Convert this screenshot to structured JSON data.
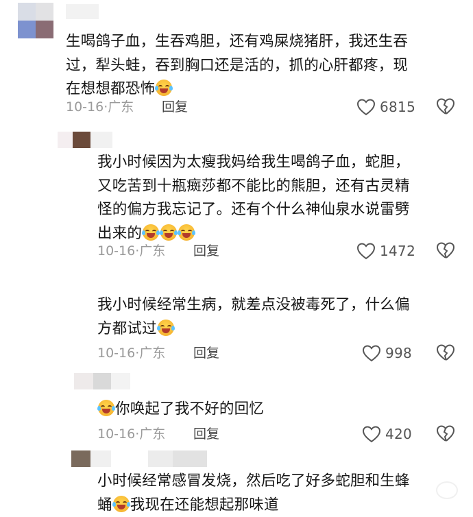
{
  "comments": [
    {
      "text": "生喝鸽子血，生吞鸡胆，还有鸡屎烧猪肝，我还生吞\n过，犁头蛙，吞到胸口还是活的，抓的心肝都疼，现\n在想想都恐怖",
      "emoji_count": 1,
      "date": "10-16",
      "location": "广东",
      "reply_label": "回复",
      "likes": "6815"
    },
    {
      "text": "我小时候因为太瘦我妈给我生喝鸽子血，蛇胆，\n又吃苦到十瓶癍莎都不能比的熊胆，还有古灵精\n怪的偏方我忘记了。还有个什么神仙泉水说雷劈\n出来的",
      "emoji_count": 3,
      "date": "10-16",
      "location": "广东",
      "reply_label": "回复",
      "likes": "1472"
    },
    {
      "text": "我小时候经常生病，就差点没被毒死了，什么偏\n方都试过",
      "emoji_count": 1,
      "date": "10-16",
      "location": "广东",
      "reply_label": "回复",
      "likes": "998"
    },
    {
      "text_prefix_emoji": true,
      "text": "你唤起了我不好的回忆",
      "date": "10-16",
      "location": "广东",
      "reply_label": "回复",
      "likes": "420"
    },
    {
      "text": "小时候经常感冒发烧，然后吃了好多蛇胆和生蜂\n蛹",
      "text_tail": "我现在还能想起那味道"
    }
  ],
  "meta_separator": "·",
  "colors": {
    "text": "#161616",
    "meta": "#9a9a9a",
    "icon": "#555555"
  },
  "icons": [
    "heart-outline-icon",
    "broken-heart-icon",
    "laughing-crying-emoji"
  ]
}
